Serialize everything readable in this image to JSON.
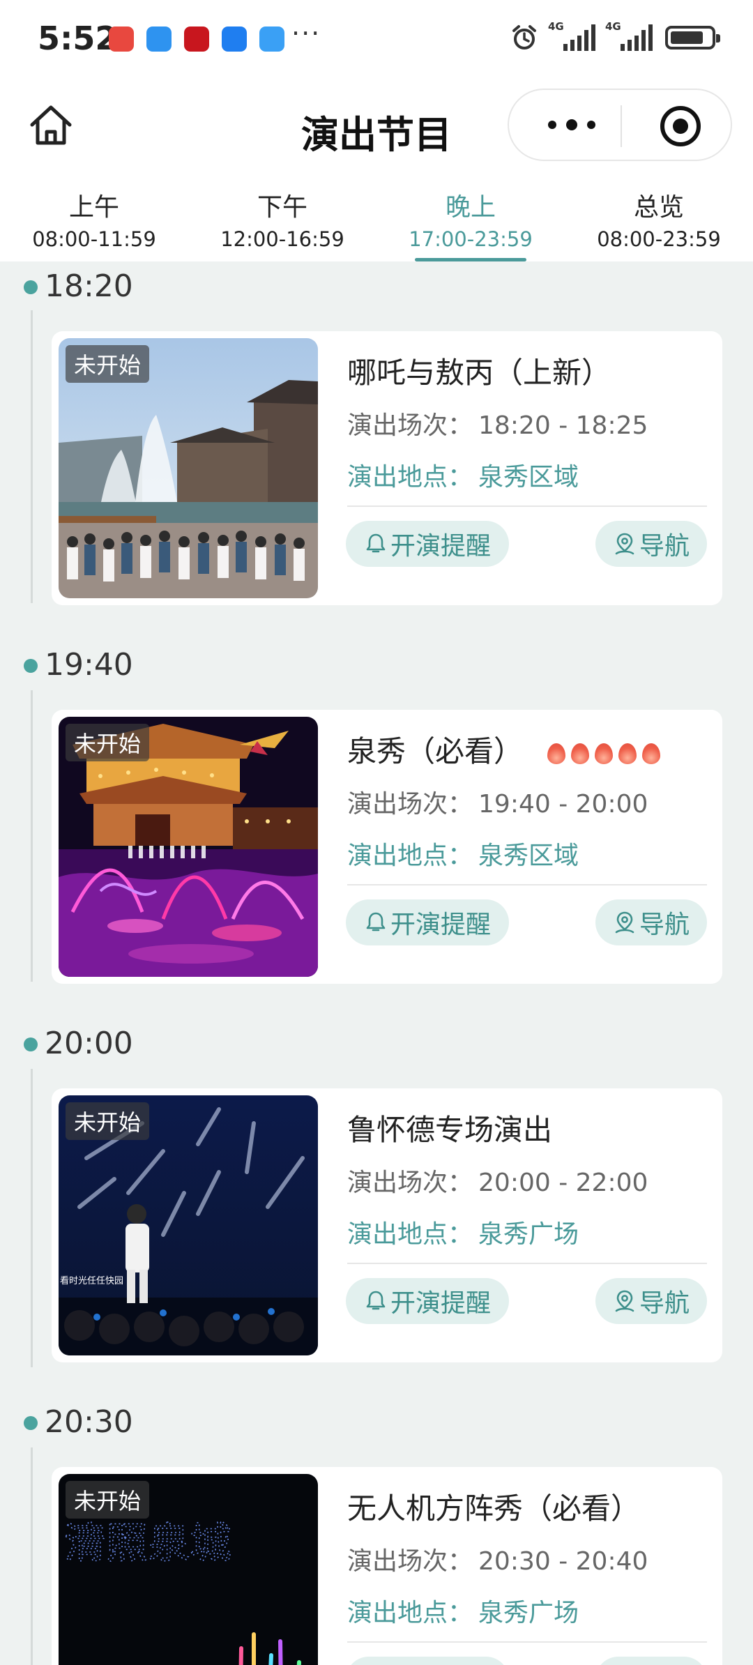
{
  "status_bar": {
    "time": "5:52",
    "app_icon_colors": [
      "#e8483f",
      "#2e93f0",
      "#c8161e",
      "#1f7ef0",
      "#3aa0f5"
    ],
    "network_labels": [
      "4G",
      "4G"
    ]
  },
  "nav": {
    "title": "演出节目"
  },
  "tabs": [
    {
      "label": "上午",
      "range": "08:00-11:59",
      "active": false
    },
    {
      "label": "下午",
      "range": "12:00-16:59",
      "active": false
    },
    {
      "label": "晚上",
      "range": "17:00-23:59",
      "active": true
    },
    {
      "label": "总览",
      "range": "08:00-23:59",
      "active": false
    }
  ],
  "common": {
    "session_label": "演出场次：",
    "place_label": "演出地点：",
    "remind_label": "开演提醒",
    "nav_label": "导航"
  },
  "colors": {
    "accent": "#4a9a9a",
    "button_bg": "#e2f0ee",
    "page_bg": "#eef2f1"
  },
  "events": [
    {
      "time": "18:20",
      "badge": "未开始",
      "title": "哪吒与敖丙（上新）",
      "session": "18:20 - 18:25",
      "place": "泉秀区域",
      "hot": 0
    },
    {
      "time": "19:40",
      "badge": "未开始",
      "title": "泉秀（必看）",
      "session": "19:40 - 20:00",
      "place": "泉秀区域",
      "hot": 5
    },
    {
      "time": "20:00",
      "badge": "未开始",
      "title": "鲁怀德专场演出",
      "session": "20:00 - 22:00",
      "place": "泉秀广场",
      "hot": 0
    },
    {
      "time": "20:30",
      "badge": "未开始",
      "title": "无人机方阵秀（必看）",
      "session": "20:30 - 20:40",
      "place": "泉秀广场",
      "hot": 0
    }
  ],
  "thumb_overlays": {
    "event3_caption": "看时光任任快园",
    "event4_drone_text": "清照泉城"
  }
}
